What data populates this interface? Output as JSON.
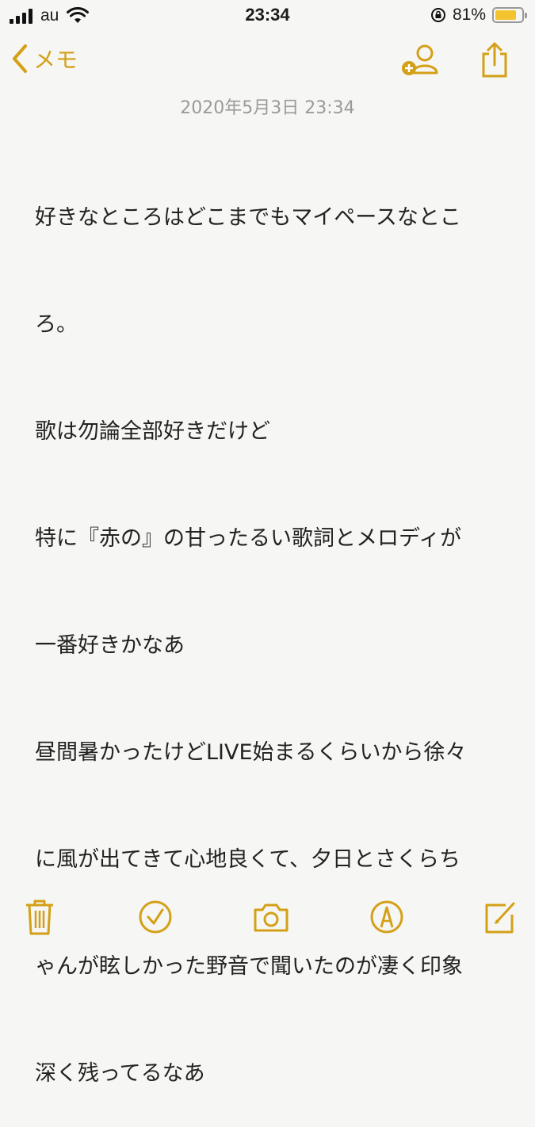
{
  "status": {
    "carrier": "au",
    "time": "23:34",
    "battery_percent": "81%",
    "battery_level": 0.81,
    "icons": [
      "signal-icon",
      "wifi-icon",
      "orientation-lock-icon",
      "battery-icon"
    ]
  },
  "nav": {
    "back_label": "メモ",
    "icons": [
      "chevron-left-icon",
      "add-people-icon",
      "share-icon"
    ]
  },
  "note": {
    "date": "2020年5月3日 23:34",
    "lines": [
      "好きなところはどこまでもマイペースなとこ",
      "ろ。",
      "歌は勿論全部好きだけど",
      "特に『赤の』の甘ったるい歌詞とメロディが",
      "一番好きかなあ",
      "昼間暑かったけどLIVE始まるくらいから徐々",
      "に風が出てきて心地良くて、夕日とさくらち",
      "ゃんが眩しかった野音で聞いたのが凄く印象",
      "深く残ってるなあ"
    ]
  },
  "toolbar": {
    "icons": [
      "trash-icon",
      "checklist-icon",
      "camera-icon",
      "markup-icon",
      "compose-icon"
    ]
  },
  "colors": {
    "accent": "#d4a017",
    "background": "#f6f6f4",
    "date_text": "#9a9a9a"
  }
}
